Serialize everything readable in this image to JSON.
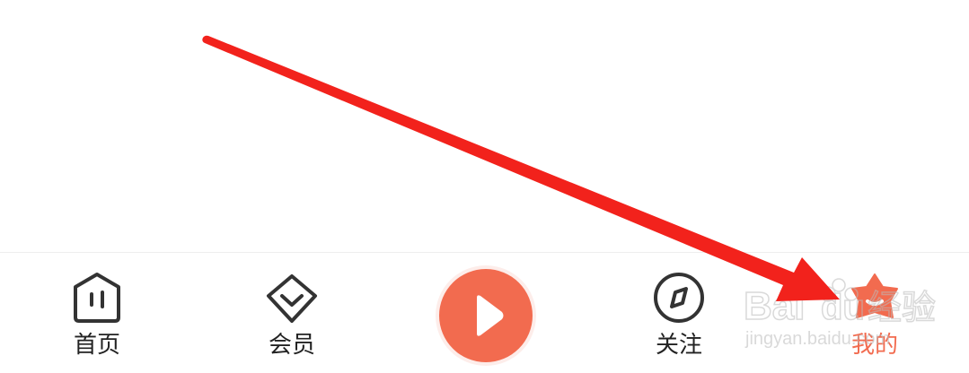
{
  "tabbar": {
    "tabs": [
      {
        "id": "home",
        "label": "首页",
        "icon": "home-icon",
        "active": false
      },
      {
        "id": "vip",
        "label": "会员",
        "icon": "diamond-icon",
        "active": false
      },
      {
        "id": "play",
        "label": "",
        "icon": "play-icon",
        "active": false
      },
      {
        "id": "follow",
        "label": "关注",
        "icon": "compass-icon",
        "active": false
      },
      {
        "id": "mine",
        "label": "我的",
        "icon": "star-house-icon",
        "active": true
      }
    ]
  },
  "colors": {
    "accent": "#f26b4f",
    "annotation_arrow": "#f2221c",
    "text": "#222222",
    "icon_stroke": "#333333"
  },
  "watermark": {
    "brand": "Baidu经验",
    "url": "jingyan.baidu.com"
  }
}
